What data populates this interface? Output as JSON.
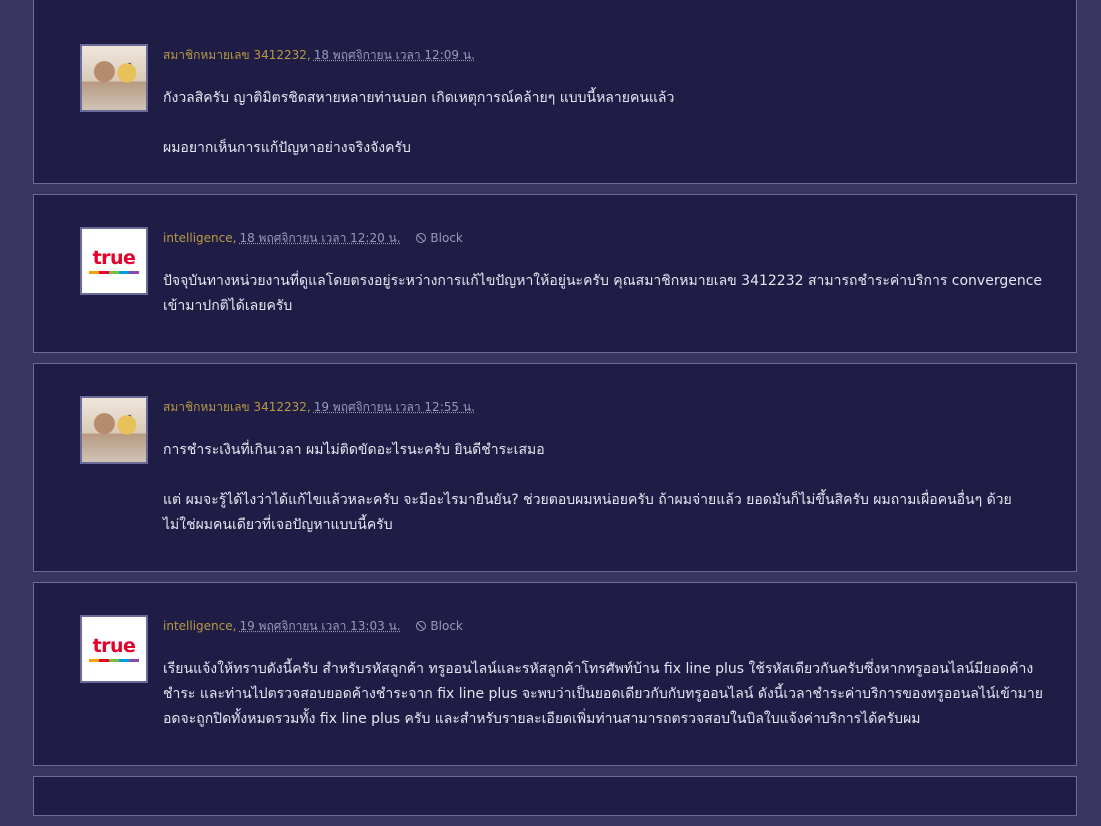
{
  "comments": [
    {
      "author": "สมาชิกหมายเลข 3412232",
      "date": "18 พฤศจิกายน เวลา 12:09 น.",
      "avatar": "user-avatar-photo",
      "paragraphs": [
        "กังวลสิครับ ญาติมิตรชิดสหายหลายท่านบอก เกิดเหตุการณ์คล้ายๆ แบบนี้หลายคนแล้ว",
        "ผมอยากเห็นการแก้ปัญหาอย่างจริงจังครับ"
      ]
    },
    {
      "author": "intelligence",
      "date": "18 พฤศจิกายน เวลา 12:20 น.",
      "block_label": "Block",
      "avatar": "true-logo",
      "logo_text": "true",
      "paragraphs": [
        "ปัจจุบันทางหน่วยงานที่ดูแลโดยตรงอยู่ระหว่างการแก้ไขปัญหาให้อยู่นะครับ คุณสมาชิกหมายเลข 3412232 สามารถชำระค่าบริการ convergence เข้ามาปกติได้เลยครับ"
      ]
    },
    {
      "author": "สมาชิกหมายเลข 3412232",
      "date": "19 พฤศจิกายน เวลา 12:55 น.",
      "avatar": "user-avatar-photo",
      "paragraphs": [
        "การชำระเงินที่เกินเวลา ผมไม่ติดขัดอะไรนะครับ ยินดีชำระเสมอ",
        "แต่ ผมจะรู้ได้ไงว่าได้แก้ไขแล้วหละครับ จะมีอะไรมายืนยัน? ช่วยตอบผมหน่อยครับ ถ้าผมจ่ายแล้ว ยอดมันก็ไม่ขึ้นสิครับ ผมถามเผื่อคนอื่นๆ ด้วย ไม่ใช่ผมคนเดียวที่เจอปัญหาแบบนี้ครับ"
      ]
    },
    {
      "author": "intelligence",
      "date": "19 พฤศจิกายน เวลา 13:03 น.",
      "block_label": "Block",
      "avatar": "true-logo",
      "logo_text": "true",
      "paragraphs": [
        "เรียนแจ้งให้ทราบดังนี้ครับ สำหรับรหัสลูกค้า ทรูออนไลน์และรหัสลูกค้าโทรศัพท์บ้าน fix line plus ใช้รหัสเดียวกันครับซึ่งหากทรูออนไลน์มียอดค้างชำระ และท่านไปตรวจสอบยอดค้างชำระจาก fix line plus จะพบว่าเป็นยอดเดียวกับกับทรูออนไลน์ ดังนี้เวลาชำระค่าบริการของทรูออนลไน์เข้ามายอดจะถูกปิดทั้งหมดรวมทั้ง fix line plus ครับ และสำหรับรายละเอียดเพิ่มท่านสามารถตรวจสอบในบิลใบแจ้งค่าบริการได้ครับผม"
      ]
    }
  ]
}
